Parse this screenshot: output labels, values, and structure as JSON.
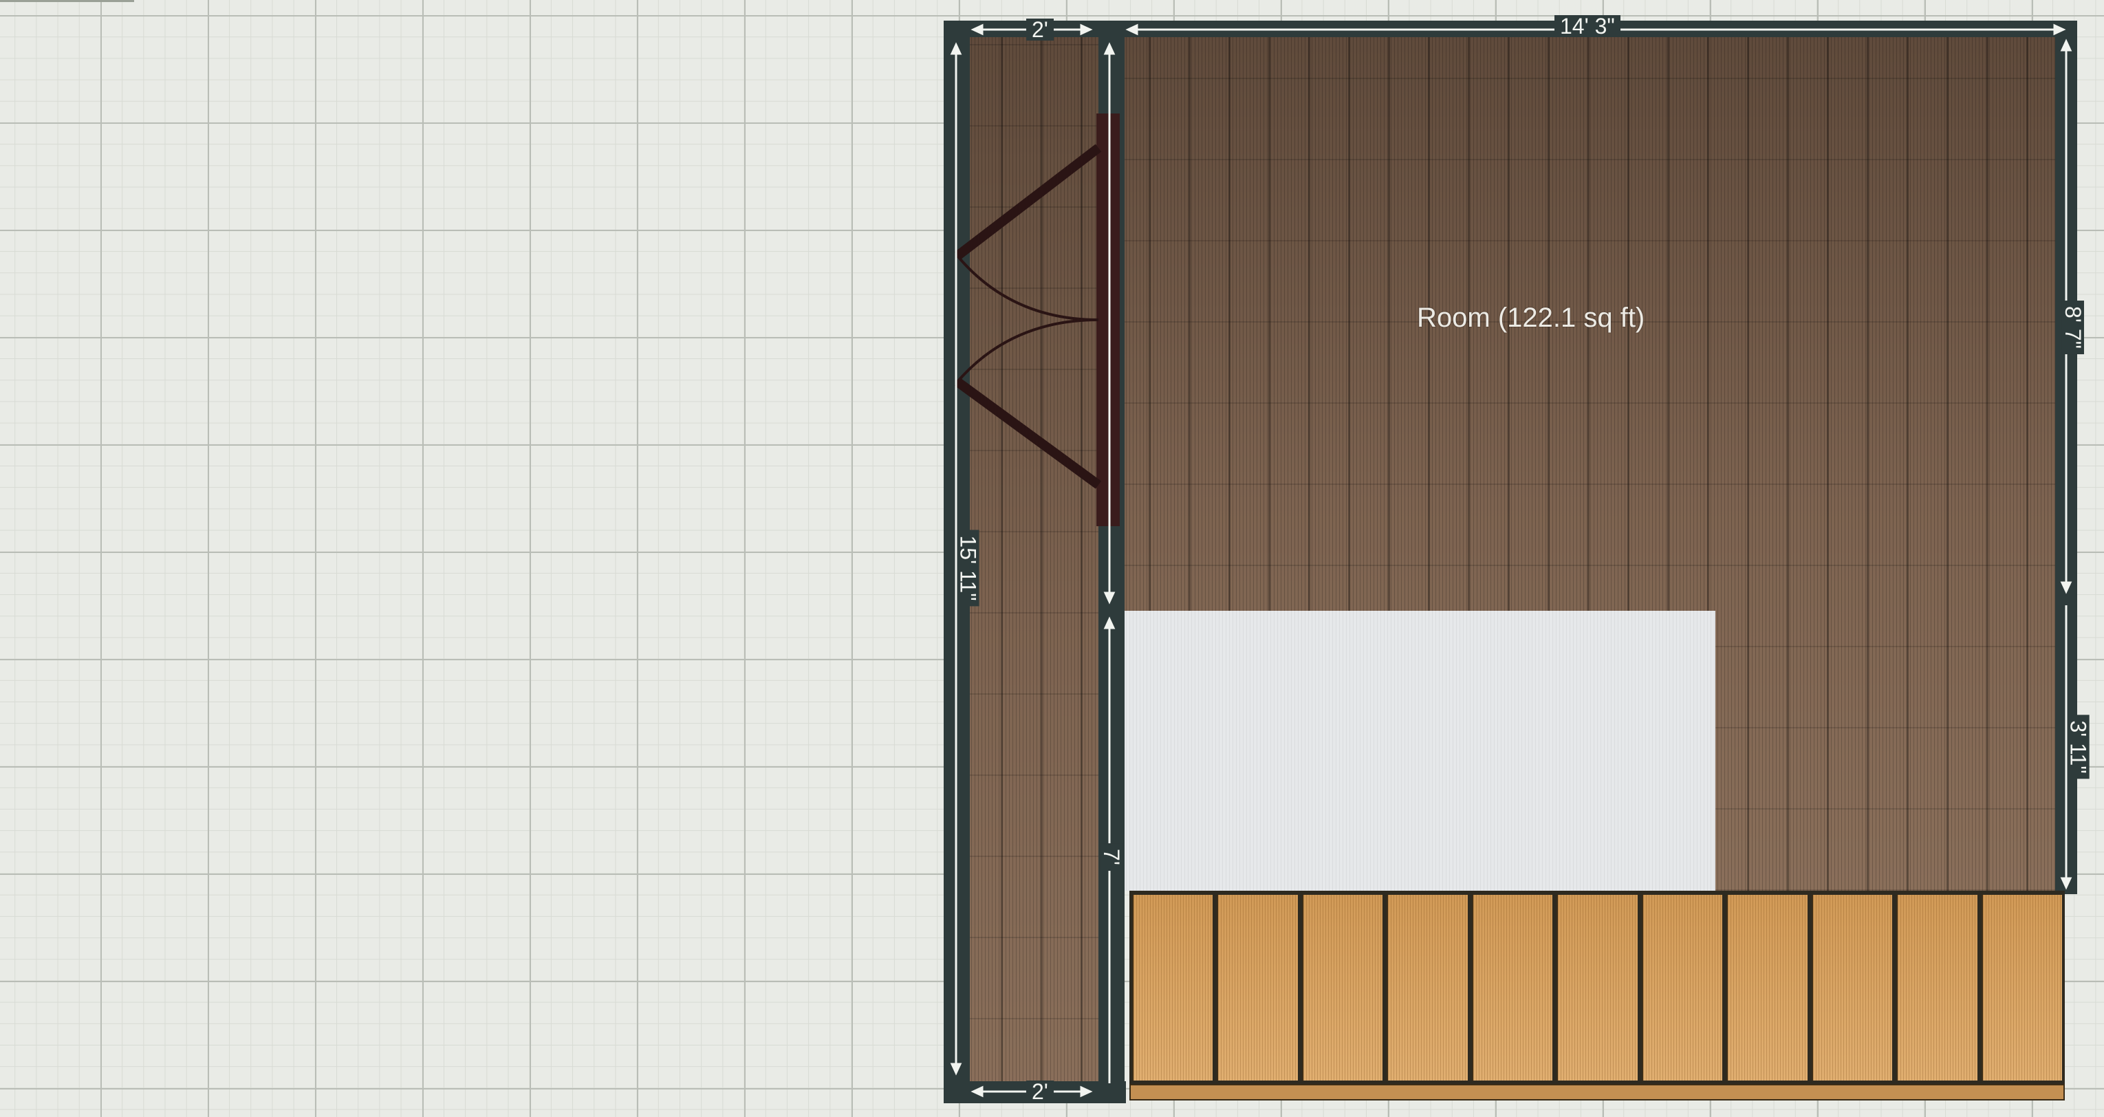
{
  "room": {
    "label": "Room (122.1 sq ft)"
  },
  "dimensions": {
    "top_width": "14' 3\"",
    "closet_top_width": "2'",
    "closet_bottom_width": "2'",
    "left_height": "15' 11\"",
    "right_upper_height": "8' 7\"",
    "right_lower_height": "3' 11\"",
    "partition_lower_label": "7'"
  },
  "colors": {
    "wall": "#2e3b3b",
    "door": "#3a1c1c",
    "floor_wood": "#6e5644",
    "shelf_wood": "#d9a463",
    "cutout": "#e6e8ea",
    "grid_background": "#e9ebe6"
  },
  "shelf": {
    "units": 11
  },
  "icons": {
    "door_swing": "double-door-icon",
    "dimension_arrows": "arrow-icon"
  }
}
